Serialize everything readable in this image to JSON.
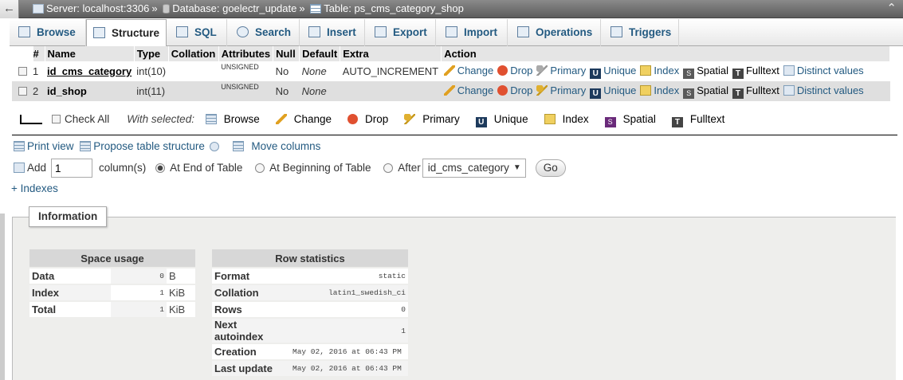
{
  "breadcrumb": {
    "back": "←",
    "server": "Server: localhost:3306",
    "database": "Database: goelectr_update",
    "table": "Table: ps_cms_category_shop",
    "sep": "»",
    "collapse": "⌃"
  },
  "tabs": [
    "Browse",
    "Structure",
    "SQL",
    "Search",
    "Insert",
    "Export",
    "Import",
    "Operations",
    "Triggers"
  ],
  "active_tab": "Structure",
  "columns": {
    "num": "#",
    "name": "Name",
    "type": "Type",
    "collation": "Collation",
    "attributes": "Attributes",
    "null": "Null",
    "default": "Default",
    "extra": "Extra",
    "action": "Action"
  },
  "rows": [
    {
      "num": "1",
      "name": "id_cms_category",
      "type": "int(10)",
      "collation": "",
      "attributes": "UNSIGNED",
      "null": "No",
      "default": "None",
      "extra": "AUTO_INCREMENT"
    },
    {
      "num": "2",
      "name": "id_shop",
      "type": "int(11)",
      "collation": "",
      "attributes": "UNSIGNED",
      "null": "No",
      "default": "None",
      "extra": ""
    }
  ],
  "row_actions": {
    "change": "Change",
    "drop": "Drop",
    "primary": "Primary",
    "unique": "Unique",
    "index": "Index",
    "spatial": "Spatial",
    "fulltext": "Fulltext",
    "distinct": "Distinct values"
  },
  "with_selected": {
    "check_all": "Check All",
    "label": "With selected:",
    "browse": "Browse",
    "change": "Change",
    "drop": "Drop",
    "primary": "Primary",
    "unique": "Unique",
    "index": "Index",
    "spatial": "Spatial",
    "fulltext": "Fulltext"
  },
  "links": {
    "print": "Print view",
    "propose": "Propose table structure",
    "move": "Move columns"
  },
  "add": {
    "label": "Add",
    "count": "1",
    "columns": "column(s)",
    "end": "At End of Table",
    "beginning": "At Beginning of Table",
    "after": "After",
    "after_select": "id_cms_category",
    "go": "Go"
  },
  "indexes": "+ Indexes",
  "information": "Information",
  "space_usage": {
    "title": "Space usage",
    "rows": [
      {
        "k": "Data",
        "v": "0",
        "u": "B"
      },
      {
        "k": "Index",
        "v": "1",
        "u": "KiB"
      },
      {
        "k": "Total",
        "v": "1",
        "u": "KiB"
      }
    ]
  },
  "row_statistics": {
    "title": "Row statistics",
    "rows": [
      {
        "k": "Format",
        "v": "static"
      },
      {
        "k": "Collation",
        "v": "latin1_swedish_ci"
      },
      {
        "k": "Rows",
        "v": "0"
      },
      {
        "k": "Next autoindex",
        "v": "1"
      },
      {
        "k": "Creation",
        "v": "May 02, 2016 at 06:43 PM"
      },
      {
        "k": "Last update",
        "v": "May 02, 2016 at 06:43 PM"
      }
    ]
  }
}
